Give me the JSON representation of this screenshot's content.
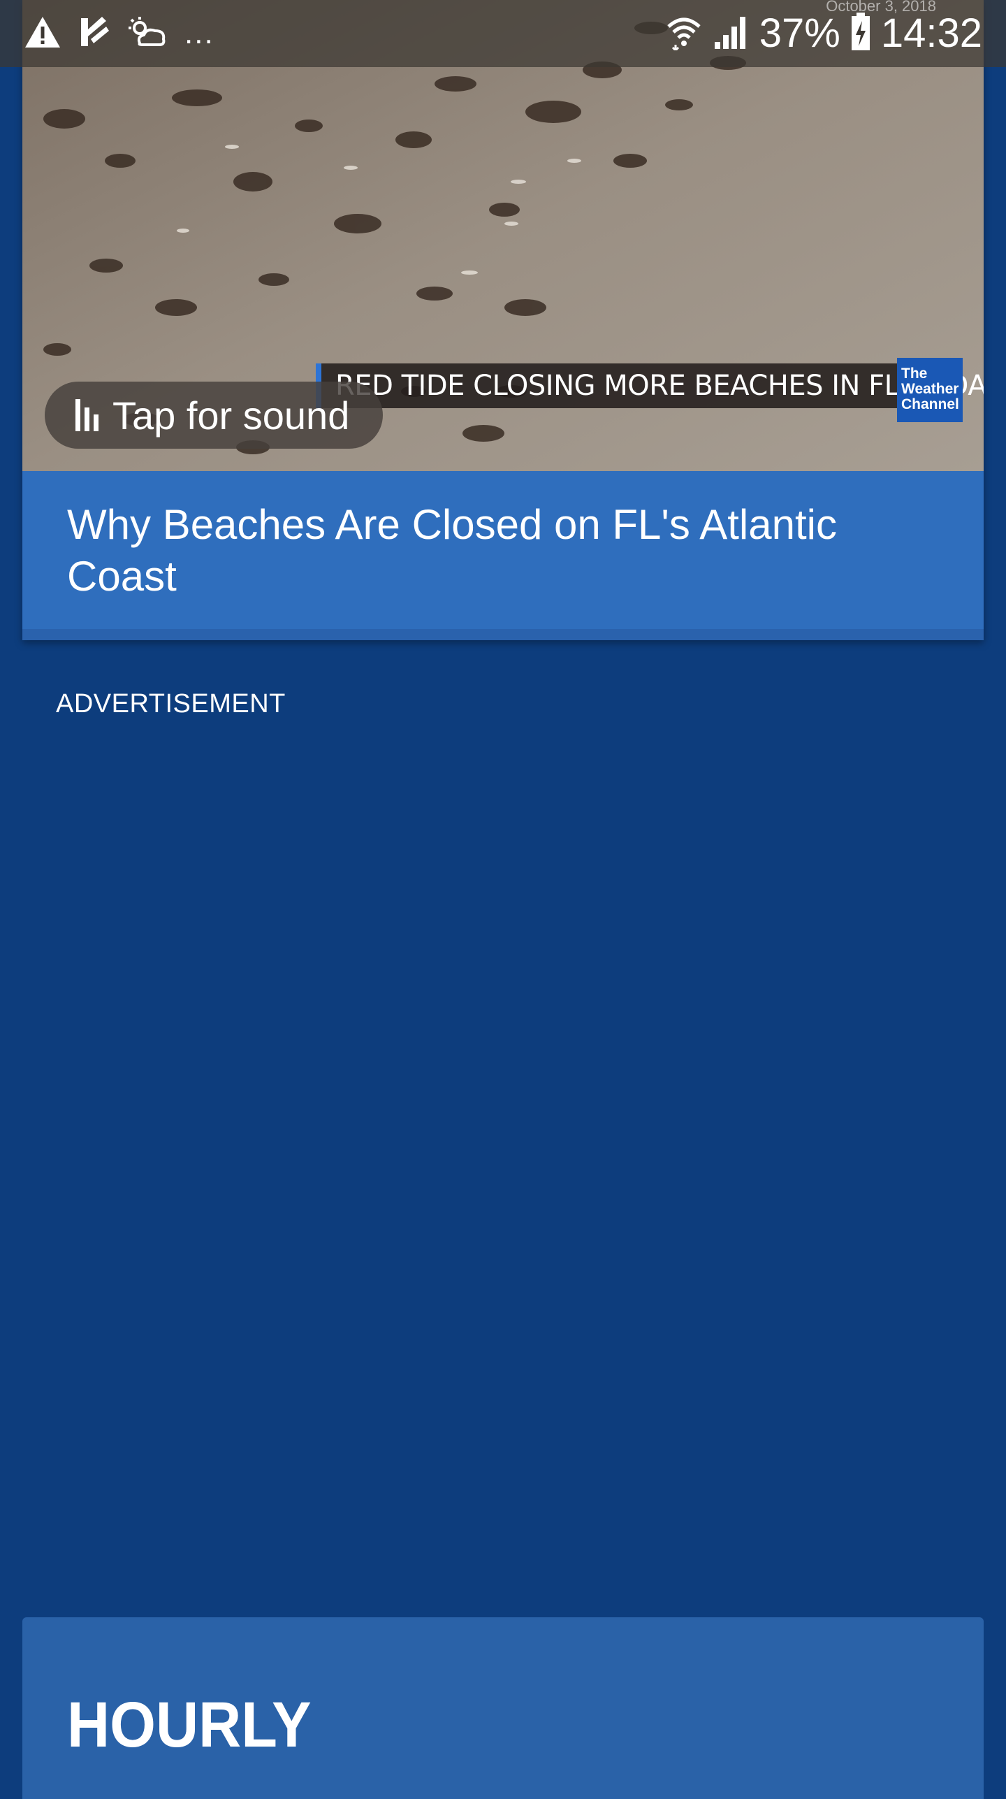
{
  "status_bar": {
    "date": "October 3, 2018",
    "overflow": "...",
    "battery": "37%",
    "time": "14:32",
    "icons": [
      "warning-icon",
      "check-flag-icon",
      "partly-cloudy-icon",
      "wifi-icon",
      "signal-icon",
      "battery-charging-icon"
    ]
  },
  "video": {
    "caption": "RED TIDE CLOSING MORE BEACHES IN FLORIDA",
    "logo_lines": [
      "The",
      "Weather",
      "Channel"
    ],
    "sound_button": "Tap for sound",
    "headline": "Why Beaches Are Closed on FL's Atlantic Coast"
  },
  "advertisement": {
    "label": "ADVERTISEMENT"
  },
  "hourly": {
    "title": "HOURLY"
  },
  "colors": {
    "page_bg": "#0d3d7d",
    "headline_bg": "#2f6ebd",
    "hourly_bg": "#2a62a8",
    "logo_bg": "#1a58b5"
  }
}
